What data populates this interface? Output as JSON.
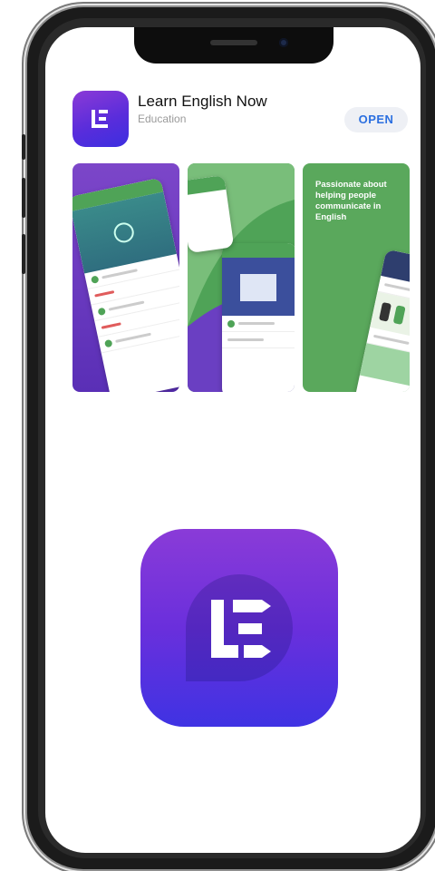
{
  "app": {
    "title": "Learn English Now",
    "category": "Education",
    "open_label": "OPEN"
  },
  "screenshots": {
    "third_caption": "Passionate about helping people communicate in English"
  },
  "icons": {
    "logo": "learn-english-now-logo-icon"
  },
  "colors": {
    "brand_purple": "#6a2fdc",
    "brand_green": "#4fa357",
    "open_blue": "#2b6fe0"
  }
}
